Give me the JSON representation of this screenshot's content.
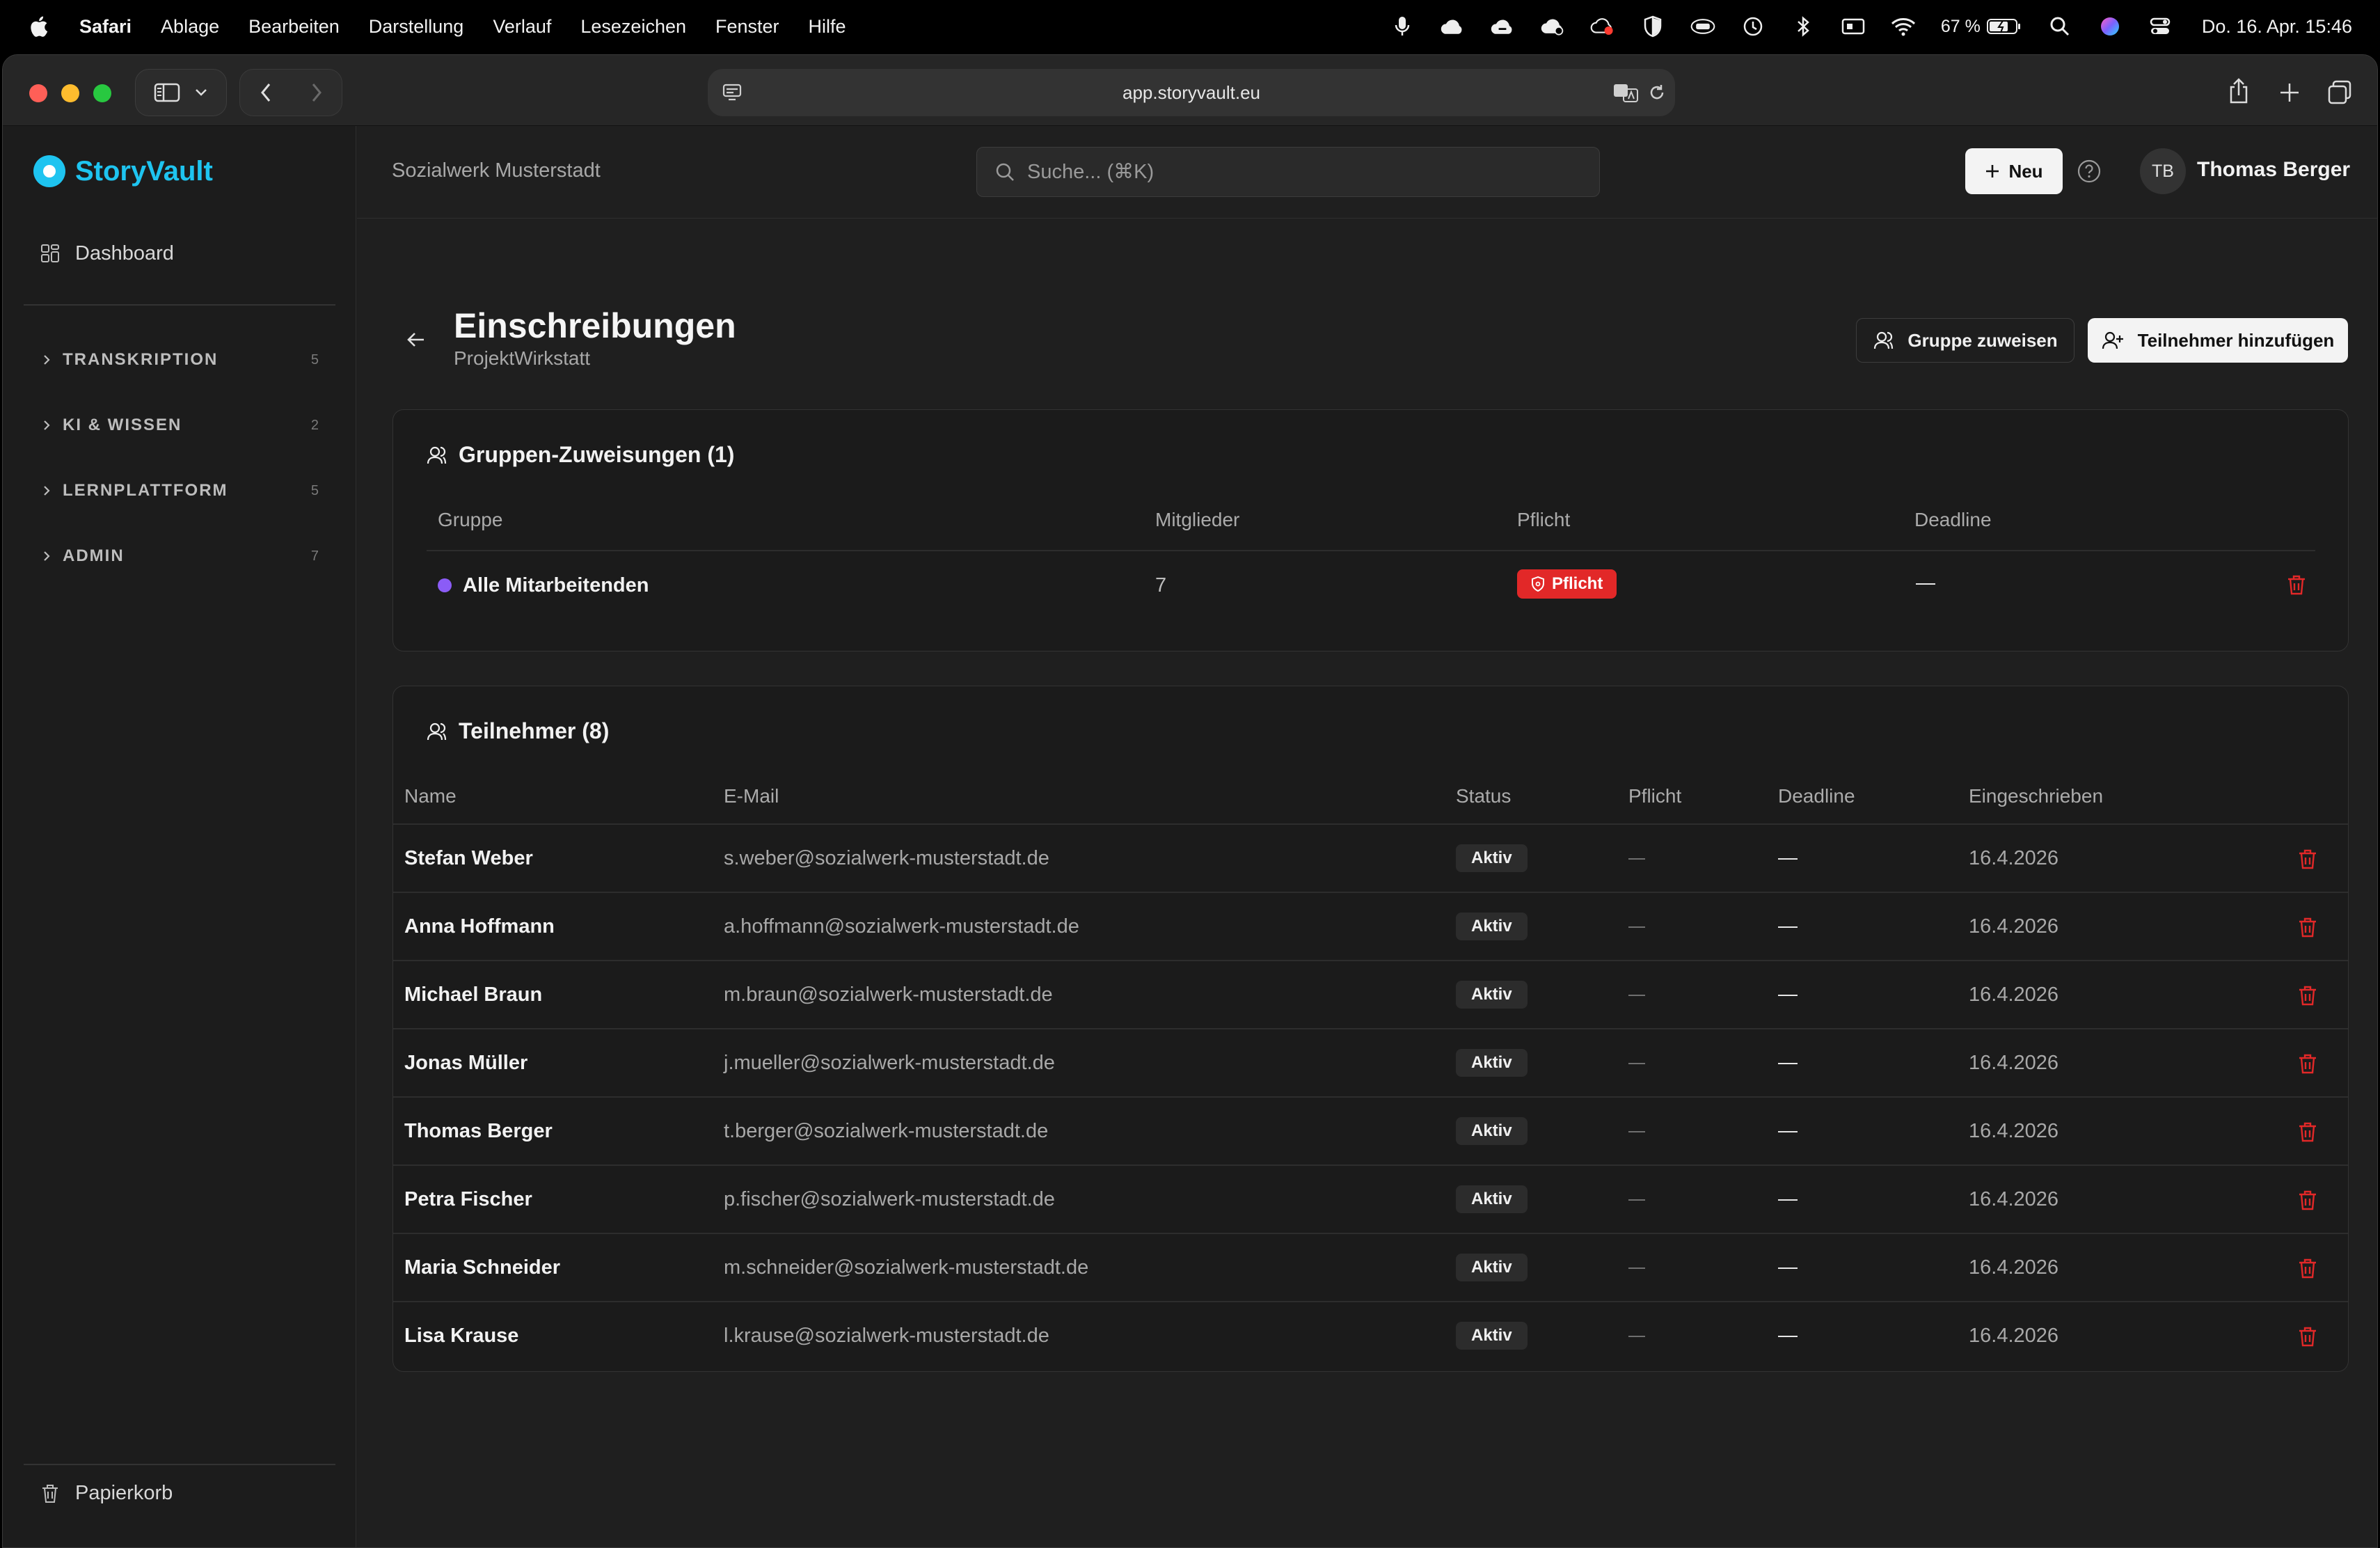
{
  "menubar": {
    "app": "Safari",
    "items": [
      "Ablage",
      "Bearbeiten",
      "Darstellung",
      "Verlauf",
      "Lesezeichen",
      "Fenster",
      "Hilfe"
    ],
    "battery": "67 %",
    "clock": "Do. 16. Apr.  15:46"
  },
  "browser": {
    "url": "app.storyvault.eu"
  },
  "sidebar": {
    "brand": "StoryVault",
    "dashboard": "Dashboard",
    "sections": [
      {
        "label": "TRANSKRIPTION",
        "count": "5"
      },
      {
        "label": "KI & WISSEN",
        "count": "2"
      },
      {
        "label": "LERNPLATTFORM",
        "count": "5"
      },
      {
        "label": "ADMIN",
        "count": "7"
      }
    ],
    "trash": "Papierkorb"
  },
  "header": {
    "org": "Sozialwerk Musterstadt",
    "search_placeholder": "Suche... (⌘K)",
    "new_label": "Neu",
    "user_initials": "TB",
    "user_name": "Thomas Berger"
  },
  "page": {
    "title": "Einschreibungen",
    "subtitle": "ProjektWirkstatt",
    "assign_group": "Gruppe zuweisen",
    "add_participant": "Teilnehmer hinzufügen"
  },
  "groups": {
    "title": "Gruppen-Zuweisungen (1)",
    "columns": [
      "Gruppe",
      "Mitglieder",
      "Pflicht",
      "Deadline"
    ],
    "rows": [
      {
        "name": "Alle Mitarbeitenden",
        "members": "7",
        "pflicht": "Pflicht",
        "deadline": "—",
        "dot_color": "#8b5cf6"
      }
    ]
  },
  "participants": {
    "title": "Teilnehmer (8)",
    "columns": [
      "Name",
      "E-Mail",
      "Status",
      "Pflicht",
      "Deadline",
      "Eingeschrieben"
    ],
    "rows": [
      {
        "name": "Stefan Weber",
        "email": "s.weber@sozialwerk-musterstadt.de",
        "status": "Aktiv",
        "pflicht": "—",
        "deadline": "—",
        "date": "16.4.2026"
      },
      {
        "name": "Anna Hoffmann",
        "email": "a.hoffmann@sozialwerk-musterstadt.de",
        "status": "Aktiv",
        "pflicht": "—",
        "deadline": "—",
        "date": "16.4.2026"
      },
      {
        "name": "Michael Braun",
        "email": "m.braun@sozialwerk-musterstadt.de",
        "status": "Aktiv",
        "pflicht": "—",
        "deadline": "—",
        "date": "16.4.2026"
      },
      {
        "name": "Jonas Müller",
        "email": "j.mueller@sozialwerk-musterstadt.de",
        "status": "Aktiv",
        "pflicht": "—",
        "deadline": "—",
        "date": "16.4.2026"
      },
      {
        "name": "Thomas Berger",
        "email": "t.berger@sozialwerk-musterstadt.de",
        "status": "Aktiv",
        "pflicht": "—",
        "deadline": "—",
        "date": "16.4.2026"
      },
      {
        "name": "Petra Fischer",
        "email": "p.fischer@sozialwerk-musterstadt.de",
        "status": "Aktiv",
        "pflicht": "—",
        "deadline": "—",
        "date": "16.4.2026"
      },
      {
        "name": "Maria Schneider",
        "email": "m.schneider@sozialwerk-musterstadt.de",
        "status": "Aktiv",
        "pflicht": "—",
        "deadline": "—",
        "date": "16.4.2026"
      },
      {
        "name": "Lisa Krause",
        "email": "l.krause@sozialwerk-musterstadt.de",
        "status": "Aktiv",
        "pflicht": "—",
        "deadline": "—",
        "date": "16.4.2026"
      }
    ]
  },
  "colors": {
    "brand": "#1ec4f0",
    "danger": "#e22828",
    "background": "#1f1f1f"
  }
}
